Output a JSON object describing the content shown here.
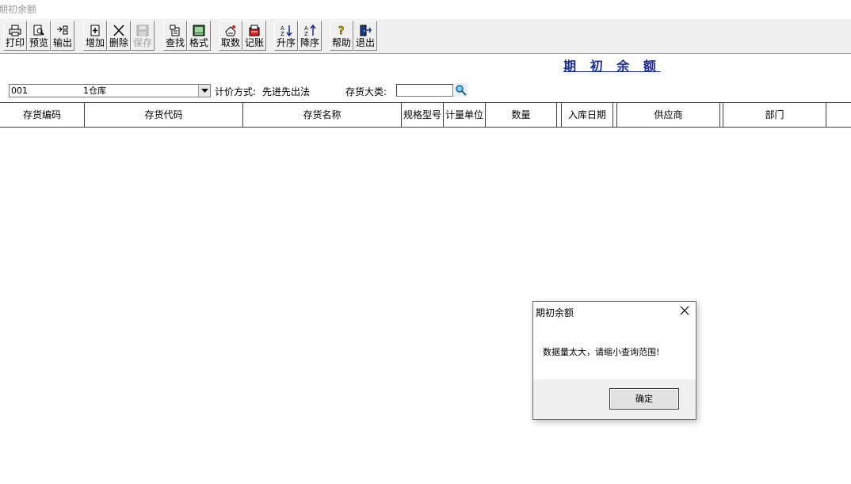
{
  "window": {
    "title": "期初余额"
  },
  "toolbar": {
    "groups": [
      [
        {
          "label": "打印",
          "icon": "printer-icon"
        },
        {
          "label": "预览",
          "icon": "preview-icon"
        },
        {
          "label": "输出",
          "icon": "export-icon"
        }
      ],
      [
        {
          "label": "增加",
          "icon": "add-icon"
        },
        {
          "label": "删除",
          "icon": "delete-icon"
        },
        {
          "label": "保存",
          "icon": "save-icon",
          "disabled": true
        }
      ],
      [
        {
          "label": "查找",
          "icon": "find-icon"
        },
        {
          "label": "格式",
          "icon": "format-icon"
        }
      ],
      [
        {
          "label": "取数",
          "icon": "fetch-icon"
        },
        {
          "label": "记账",
          "icon": "post-icon"
        }
      ],
      [
        {
          "label": "升序",
          "icon": "sort-asc-icon"
        },
        {
          "label": "降序",
          "icon": "sort-desc-icon"
        }
      ],
      [
        {
          "label": "帮助",
          "icon": "help-icon"
        },
        {
          "label": "退出",
          "icon": "exit-icon"
        }
      ]
    ]
  },
  "page": {
    "heading": "期 初 余 额"
  },
  "filter": {
    "warehouse_code": "001",
    "warehouse_name": "1仓库",
    "pricing_label": "计价方式:",
    "pricing_value": "先进先出法",
    "category_label": "存货大类:",
    "category_value": ""
  },
  "grid": {
    "columns": [
      "存货编码",
      "存货代码",
      "存货名称",
      "规格型号",
      "计量单位",
      "数量",
      "",
      "入库日期",
      "",
      "供应商",
      "",
      "部门",
      ""
    ]
  },
  "dialog": {
    "title": "期初余额",
    "message": "数据量太大，请缩小查询范围!",
    "ok_label": "确定"
  },
  "colors": {
    "heading": "#1a2a9a",
    "toolbar_bg": "#f0f0f0"
  }
}
